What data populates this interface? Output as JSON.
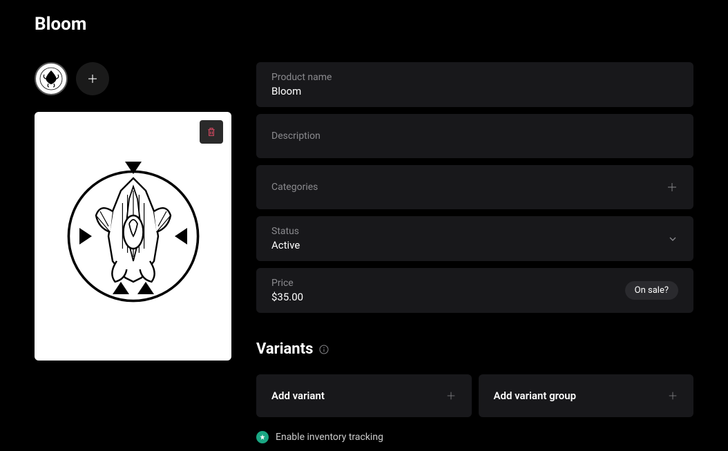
{
  "page_title": "Bloom",
  "fields": {
    "product_name": {
      "label": "Product name",
      "value": "Bloom"
    },
    "description": {
      "label": "Description"
    },
    "categories": {
      "label": "Categories"
    },
    "status": {
      "label": "Status",
      "value": "Active"
    },
    "price": {
      "label": "Price",
      "value": "$35.00",
      "badge": "On sale?"
    }
  },
  "variants": {
    "title": "Variants",
    "add_variant": "Add variant",
    "add_group": "Add variant group"
  },
  "inventory": {
    "label": "Enable inventory tracking"
  }
}
